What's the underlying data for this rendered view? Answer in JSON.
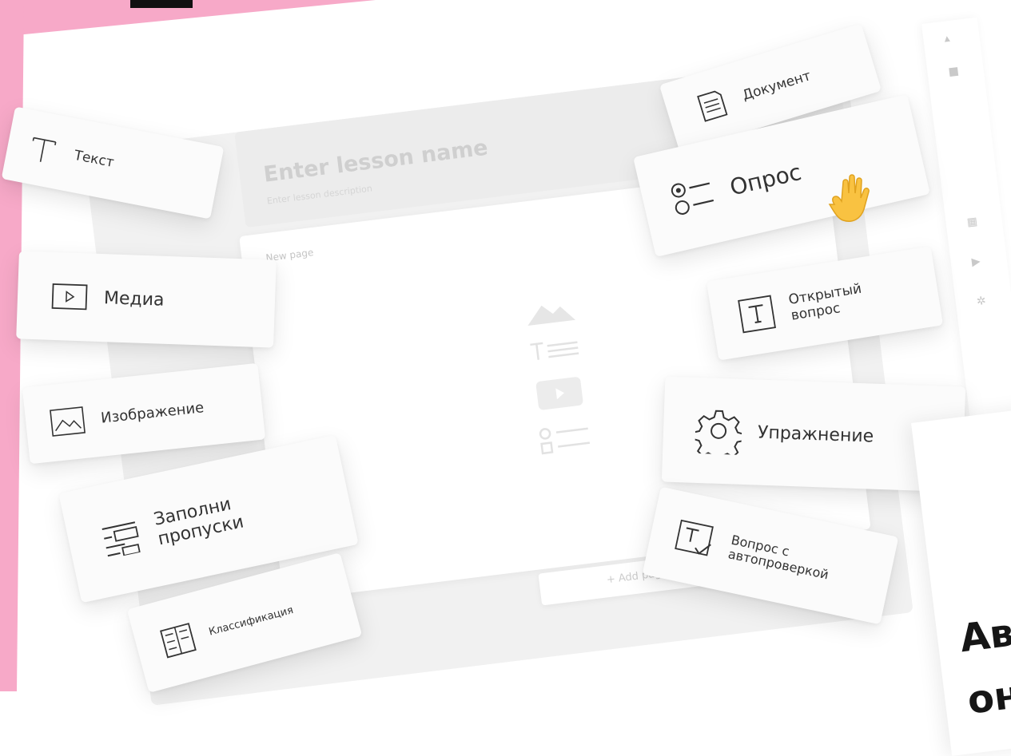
{
  "lesson": {
    "title_placeholder": "Enter lesson name",
    "description_placeholder": "Enter lesson description",
    "page_label": "New page",
    "add_label": "+ Add page"
  },
  "cards": {
    "text": "Текст",
    "media": "Медиа",
    "image": "Изображение",
    "fill_gaps": "Заполни пропуски",
    "classification": "Классификация",
    "document": "Документ",
    "poll": "Опрос",
    "open_question": "Открытый вопрос",
    "exercise": "Упражнение",
    "auto_check": "Вопрос с автопроверкой"
  },
  "overlay": {
    "heading_line1": "Авт",
    "heading_line2": "он"
  },
  "colors": {
    "accent_pink": "#f7a9c8",
    "card_bg": "#fbfbfb",
    "text_dark": "#161616"
  }
}
